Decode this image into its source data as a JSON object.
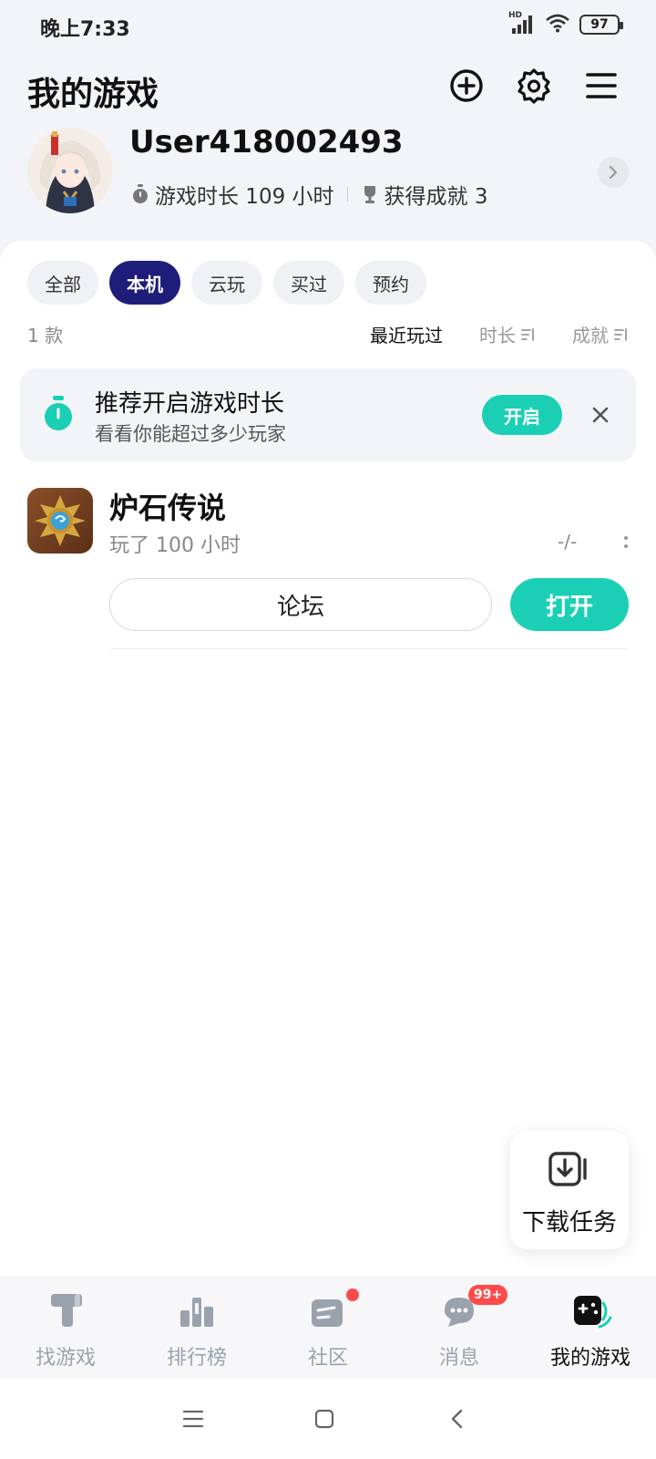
{
  "status_bar": {
    "time": "晚上7:33",
    "network_label": "HD",
    "battery": "97",
    "icons": [
      "signal-icon",
      "wifi-icon",
      "battery-icon"
    ]
  },
  "header": {
    "title": "我的游戏",
    "actions": [
      "add-circle-icon",
      "gear-icon",
      "menu-icon"
    ]
  },
  "profile": {
    "username": "User418002493",
    "playtime_label": "游戏时长 109 小时",
    "achievements_label": "获得成就 3"
  },
  "filters": {
    "tabs": [
      {
        "label": "全部",
        "active": false
      },
      {
        "label": "本机",
        "active": true
      },
      {
        "label": "云玩",
        "active": false
      },
      {
        "label": "买过",
        "active": false
      },
      {
        "label": "预约",
        "active": false
      }
    ]
  },
  "list_meta": {
    "count": "1 款",
    "sort": [
      {
        "label": "最近玩过",
        "active": true
      },
      {
        "label": "时长",
        "active": false
      },
      {
        "label": "成就",
        "active": false
      }
    ]
  },
  "banner": {
    "title": "推荐开启游戏时长",
    "subtitle": "看看你能超过多少玩家",
    "button": "开启"
  },
  "games": [
    {
      "title": "炉石传说",
      "playtime": "玩了 100 小时",
      "rank": "-/-",
      "forum_button": "论坛",
      "open_button": "打开"
    }
  ],
  "fab": {
    "label": "下载任务"
  },
  "bottom_nav": {
    "items": [
      {
        "label": "找游戏",
        "icon": "find-game-icon",
        "active": false
      },
      {
        "label": "排行榜",
        "icon": "ranking-icon",
        "active": false
      },
      {
        "label": "社区",
        "icon": "community-icon",
        "active": false
      },
      {
        "label": "消息",
        "icon": "message-icon",
        "active": false
      },
      {
        "label": "我的游戏",
        "icon": "my-games-icon",
        "active": true
      }
    ],
    "message_badge": "99+"
  },
  "colors": {
    "accent": "#1bcfb4",
    "active_chip": "#1f1d7a",
    "badge": "#ff4b4b"
  }
}
